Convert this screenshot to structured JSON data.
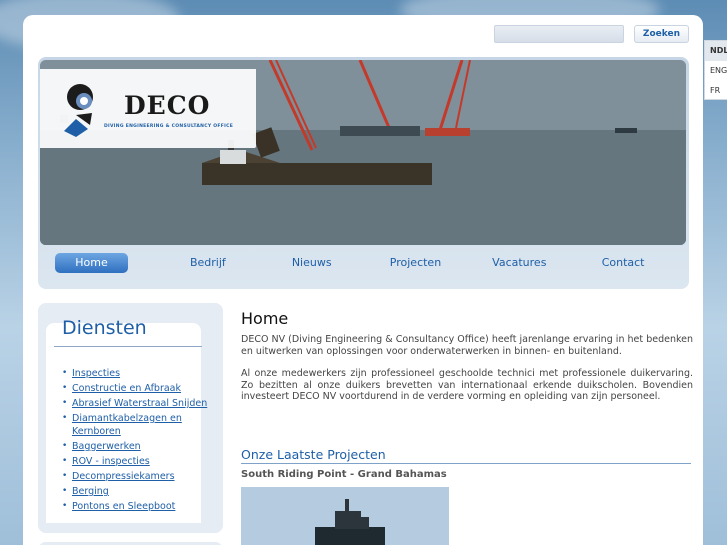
{
  "search": {
    "placeholder": "",
    "button_label": "Zoeken"
  },
  "languages": [
    {
      "label": "NDL",
      "active": true
    },
    {
      "label": "ENG",
      "active": false
    },
    {
      "label": "FR",
      "active": false
    }
  ],
  "logo": {
    "name": "DECO",
    "subtitle": "DIVING ENGINEERING & CONSULTANCY OFFICE"
  },
  "nav": {
    "items": [
      {
        "label": "Home",
        "active": true
      },
      {
        "label": "Bedrijf",
        "active": false
      },
      {
        "label": "Nieuws",
        "active": false
      },
      {
        "label": "Projecten",
        "active": false
      },
      {
        "label": "Vacatures",
        "active": false
      },
      {
        "label": "Contact",
        "active": false
      }
    ]
  },
  "sidebar": {
    "title": "Diensten",
    "items": [
      "Inspecties",
      "Constructie en Afbraak",
      "Abrasief Waterstraal Snijden",
      "Diamantkabelzagen en Kernboren",
      "Baggerwerken",
      "ROV - inspecties",
      "Decompressiekamers",
      "Berging",
      "Pontons en Sleepboot"
    ]
  },
  "main": {
    "title": "Home",
    "paragraph1": "DECO NV (Diving Engineering & Consultancy Office) heeft jarenlange ervaring in het bedenken en uitwerken van oplossingen voor onderwaterwerken in binnen- en buitenland.",
    "paragraph2": "Al onze medewerkers zijn professioneel geschoolde technici met professionele duikervaring. Zo bezitten al onze duikers brevetten van internationaal erkende duikscholen.  Bovendien investeert DECO NV voortdurend in de verdere vorming en opleiding van zijn personeel.",
    "projects_heading": "Onze Laatste Projecten",
    "project_title": "South Riding Point - Grand Bahamas"
  },
  "colors": {
    "link": "#1e5fa7",
    "nav_active": "#2e6fc0",
    "sidebar_bg": "#e5ecf4"
  }
}
